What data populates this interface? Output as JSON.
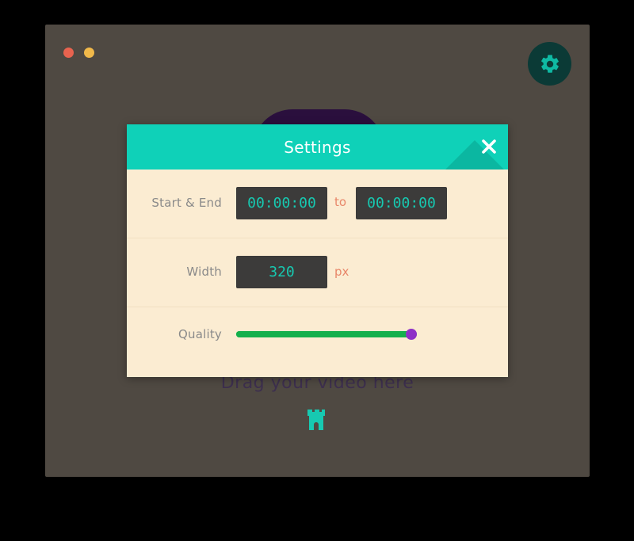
{
  "window": {
    "controls": [
      "close",
      "minimize"
    ]
  },
  "main": {
    "drop_prompt": "Drag your video here",
    "upload_icon": "castle-upload-icon"
  },
  "settings_button": {
    "icon": "gear-icon"
  },
  "modal": {
    "title": "Settings",
    "close_icon": "close-icon",
    "start_end": {
      "label": "Start & End",
      "start_value": "00:00:00",
      "connector": "to",
      "end_value": "00:00:00"
    },
    "width": {
      "label": "Width",
      "value": "320",
      "unit": "px"
    },
    "quality": {
      "label": "Quality",
      "value_fraction": 0.97
    }
  },
  "colors": {
    "accent": "#0fd1b8",
    "window_bg": "#4f4942",
    "modal_bg": "#fbecd2",
    "slider": "#1db954",
    "thumb": "#8e30c7"
  }
}
